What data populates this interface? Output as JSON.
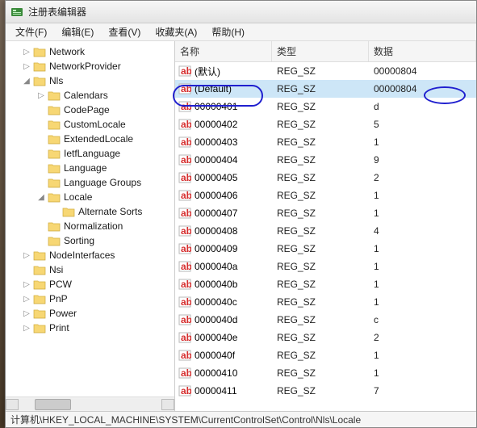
{
  "window": {
    "title": "注册表编辑器"
  },
  "menu": {
    "file": "文件(F)",
    "edit": "编辑(E)",
    "view": "查看(V)",
    "fav": "收藏夹(A)",
    "help": "帮助(H)"
  },
  "tree": [
    {
      "depth": 0,
      "expand": "closed",
      "label": "Network"
    },
    {
      "depth": 0,
      "expand": "closed",
      "label": "NetworkProvider"
    },
    {
      "depth": 0,
      "expand": "open",
      "label": "Nls"
    },
    {
      "depth": 1,
      "expand": "closed",
      "label": "Calendars"
    },
    {
      "depth": 1,
      "expand": "none",
      "label": "CodePage"
    },
    {
      "depth": 1,
      "expand": "none",
      "label": "CustomLocale"
    },
    {
      "depth": 1,
      "expand": "none",
      "label": "ExtendedLocale"
    },
    {
      "depth": 1,
      "expand": "none",
      "label": "IetfLanguage"
    },
    {
      "depth": 1,
      "expand": "none",
      "label": "Language"
    },
    {
      "depth": 1,
      "expand": "none",
      "label": "Language Groups"
    },
    {
      "depth": 1,
      "expand": "open",
      "label": "Locale"
    },
    {
      "depth": 2,
      "expand": "none",
      "label": "Alternate Sorts"
    },
    {
      "depth": 1,
      "expand": "none",
      "label": "Normalization"
    },
    {
      "depth": 1,
      "expand": "none",
      "label": "Sorting"
    },
    {
      "depth": 0,
      "expand": "closed",
      "label": "NodeInterfaces"
    },
    {
      "depth": 0,
      "expand": "none",
      "label": "Nsi"
    },
    {
      "depth": 0,
      "expand": "closed",
      "label": "PCW"
    },
    {
      "depth": 0,
      "expand": "closed",
      "label": "PnP"
    },
    {
      "depth": 0,
      "expand": "closed",
      "label": "Power"
    },
    {
      "depth": 0,
      "expand": "closed",
      "label": "Print"
    }
  ],
  "columns": {
    "name": "名称",
    "type": "类型",
    "data": "数据"
  },
  "rows": [
    {
      "name": "(默认)",
      "type": "REG_SZ",
      "data": "00000804",
      "selected": false
    },
    {
      "name": "(Default)",
      "type": "REG_SZ",
      "data": "00000804",
      "selected": true
    },
    {
      "name": "00000401",
      "type": "REG_SZ",
      "data": "d"
    },
    {
      "name": "00000402",
      "type": "REG_SZ",
      "data": "5"
    },
    {
      "name": "00000403",
      "type": "REG_SZ",
      "data": "1"
    },
    {
      "name": "00000404",
      "type": "REG_SZ",
      "data": "9"
    },
    {
      "name": "00000405",
      "type": "REG_SZ",
      "data": "2"
    },
    {
      "name": "00000406",
      "type": "REG_SZ",
      "data": "1"
    },
    {
      "name": "00000407",
      "type": "REG_SZ",
      "data": "1"
    },
    {
      "name": "00000408",
      "type": "REG_SZ",
      "data": "4"
    },
    {
      "name": "00000409",
      "type": "REG_SZ",
      "data": "1"
    },
    {
      "name": "0000040a",
      "type": "REG_SZ",
      "data": "1"
    },
    {
      "name": "0000040b",
      "type": "REG_SZ",
      "data": "1"
    },
    {
      "name": "0000040c",
      "type": "REG_SZ",
      "data": "1"
    },
    {
      "name": "0000040d",
      "type": "REG_SZ",
      "data": "c"
    },
    {
      "name": "0000040e",
      "type": "REG_SZ",
      "data": "2"
    },
    {
      "name": "0000040f",
      "type": "REG_SZ",
      "data": "1"
    },
    {
      "name": "00000410",
      "type": "REG_SZ",
      "data": "1"
    },
    {
      "name": "00000411",
      "type": "REG_SZ",
      "data": "7"
    }
  ],
  "statusbar": {
    "path": "计算机\\HKEY_LOCAL_MACHINE\\SYSTEM\\CurrentControlSet\\Control\\Nls\\Locale"
  }
}
